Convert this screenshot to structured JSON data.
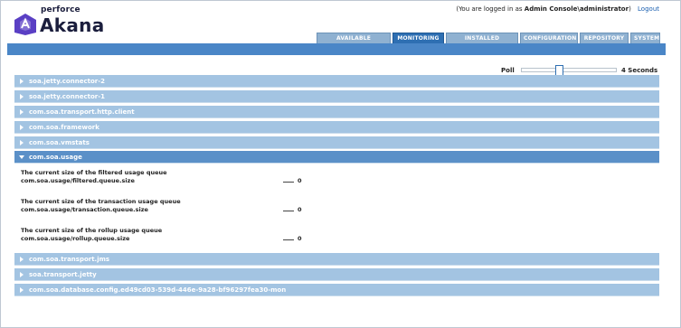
{
  "brand": {
    "top": "perforce",
    "main": "Akana",
    "logo_icon": "akana-logo-icon",
    "color": "#5a3fc4"
  },
  "login": {
    "prefix": "(You are logged in as ",
    "user": "Admin Console\\administrator",
    "suffix": ")",
    "logout": "Logout"
  },
  "tabs": [
    {
      "label": "AVAILABLE FEATURES",
      "active": false
    },
    {
      "label": "MONITORING",
      "active": true
    },
    {
      "label": "INSTALLED FEATURES",
      "active": false
    },
    {
      "label": "CONFIGURATION",
      "active": false
    },
    {
      "label": "REPOSITORY",
      "active": false
    },
    {
      "label": "SYSTEM",
      "active": false
    }
  ],
  "poll": {
    "label": "Poll",
    "value": "4 Seconds",
    "level": 0.4
  },
  "panels": [
    {
      "title": "soa.jetty.connector-2",
      "expanded": false
    },
    {
      "title": "soa.jetty.connector-1",
      "expanded": false
    },
    {
      "title": "com.soa.transport.http.client",
      "expanded": false
    },
    {
      "title": "com.soa.framework",
      "expanded": false
    },
    {
      "title": "com.soa.vmstats",
      "expanded": false
    },
    {
      "title": "com.soa.usage",
      "expanded": true
    },
    {
      "title": "com.soa.transport.jms",
      "expanded": false
    },
    {
      "title": "soa.transport.jetty",
      "expanded": false
    },
    {
      "title": "com.soa.database.config.ed49cd03-539d-446e-9a28-bf96297fea30-mon",
      "expanded": false
    }
  ],
  "usage_metrics": [
    {
      "description": "The current size of the filtered usage queue",
      "path": "com.soa.usage/filtered.queue.size",
      "value": "0"
    },
    {
      "description": "The current size of the transaction usage queue",
      "path": "com.soa.usage/transaction.queue.size",
      "value": "0"
    },
    {
      "description": "The current size of the rollup usage queue",
      "path": "com.soa.usage/rollup.queue.size",
      "value": "0"
    }
  ],
  "colors": {
    "accent": "#4a86c7",
    "tab_active": "#2e6fb2",
    "panel": "#a3c4e2",
    "panel_open": "#5b90c8"
  }
}
